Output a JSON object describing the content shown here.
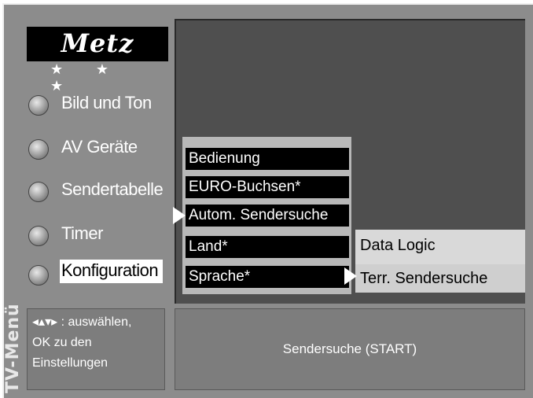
{
  "logo": {
    "brand": "Metz",
    "stars": "★ ★ ★"
  },
  "side_title": "TV-Menü",
  "main_menu": [
    {
      "label": "Bild und Ton"
    },
    {
      "label": "AV Geräte"
    },
    {
      "label": "Sendertabelle"
    },
    {
      "label": "Timer"
    },
    {
      "label": "Konfiguration",
      "selected": true
    }
  ],
  "submenu": [
    {
      "label": "Bedienung"
    },
    {
      "label": "EURO-Buchsen*"
    },
    {
      "label": "Autom. Sendersuche",
      "active": true
    },
    {
      "label": "Land*"
    },
    {
      "label": "Sprache*"
    }
  ],
  "submenu2": [
    {
      "label": "Data Logic"
    },
    {
      "label": "Terr. Sendersuche",
      "active": true
    }
  ],
  "help": {
    "line1": "◂▴▾▸ : auswählen,",
    "line2": "OK zu den",
    "line3": "Einstellungen"
  },
  "action": {
    "label": "Sendersuche (START)"
  }
}
